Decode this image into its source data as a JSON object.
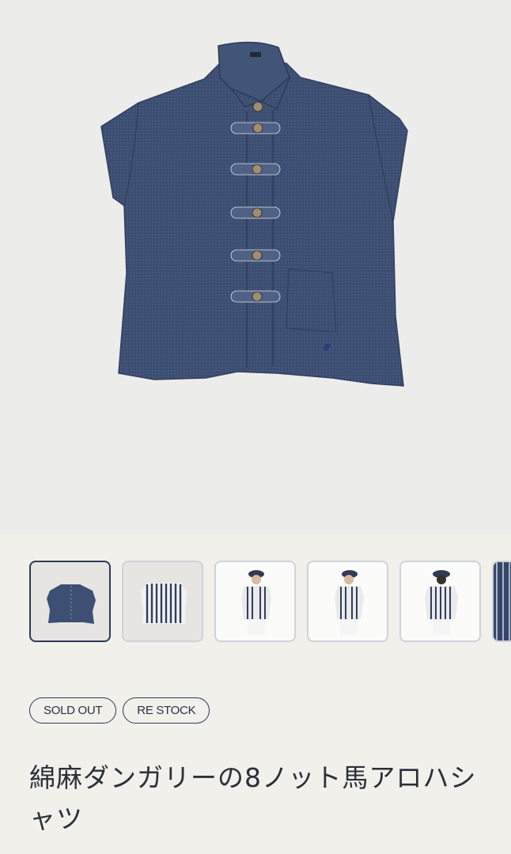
{
  "hero": {
    "image_alt": "綿麻ダンガリーの8ノット馬アロハシャツ"
  },
  "thumbnails": [
    {
      "name": "flat-front",
      "selected": true
    },
    {
      "name": "flat-back",
      "selected": false
    },
    {
      "name": "model-front",
      "selected": false
    },
    {
      "name": "model-side",
      "selected": false
    },
    {
      "name": "model-back",
      "selected": false
    },
    {
      "name": "detail",
      "selected": false
    }
  ],
  "badges": {
    "sold_out": "SOLD OUT",
    "restock": "RE STOCK"
  },
  "product": {
    "title": "綿麻ダンガリーの8ノット馬アロハシャツ"
  },
  "colors": {
    "accent": "#2c3a55",
    "denim": "#3d5074",
    "background": "#f1f0eb"
  }
}
